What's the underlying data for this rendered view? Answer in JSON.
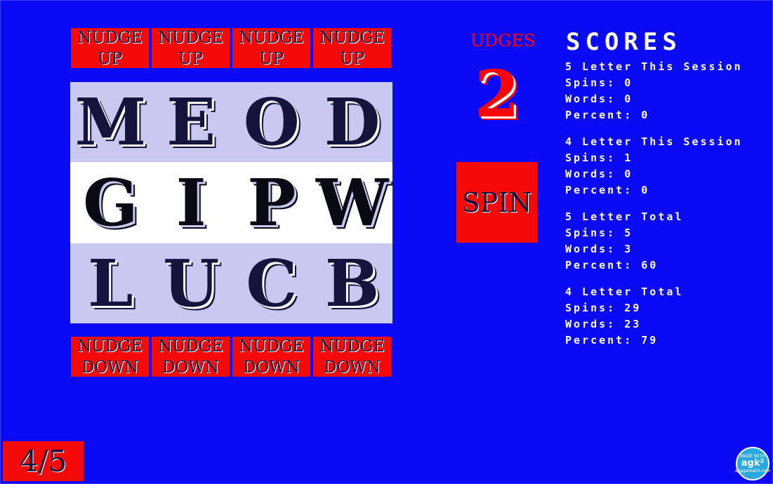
{
  "nudge_up": [
    "NUDGE\nUP",
    "NUDGE\nUP",
    "NUDGE\nUP",
    "NUDGE\nUP"
  ],
  "nudge_down": [
    "NUDGE\nDOWN",
    "NUDGE\nDOWN",
    "NUDGE\nDOWN",
    "NUDGE\nDOWN"
  ],
  "reels": [
    [
      "M",
      "E",
      "O",
      "D"
    ],
    [
      "G",
      "I",
      "P",
      "W"
    ],
    [
      "L",
      "U",
      "C",
      "B"
    ]
  ],
  "nudges": {
    "label": "UDGES",
    "count": "2"
  },
  "spin_label": "SPIN",
  "scores": {
    "title": "SCORES",
    "lines": [
      "5 Letter This Session",
      "Spins: 0",
      "Words: 0",
      "Percent: 0",
      "4 Letter This Session",
      "Spins: 1",
      "Words: 0",
      "Percent: 0",
      "5 Letter Total",
      "Spins: 5",
      "Words: 3",
      "Percent: 60",
      "4 Letter Total",
      "Spins: 29",
      "Words: 23",
      "Percent: 79"
    ]
  },
  "level": "4/5",
  "badge": {
    "top": "MADE WITH",
    "main": "agk²",
    "bottom": "appgamekit.com"
  },
  "colors": {
    "background": "#0a0af5",
    "button": "#f50a0a",
    "reel_light": "#c8c8f0",
    "reel_mid": "#ffffff"
  }
}
